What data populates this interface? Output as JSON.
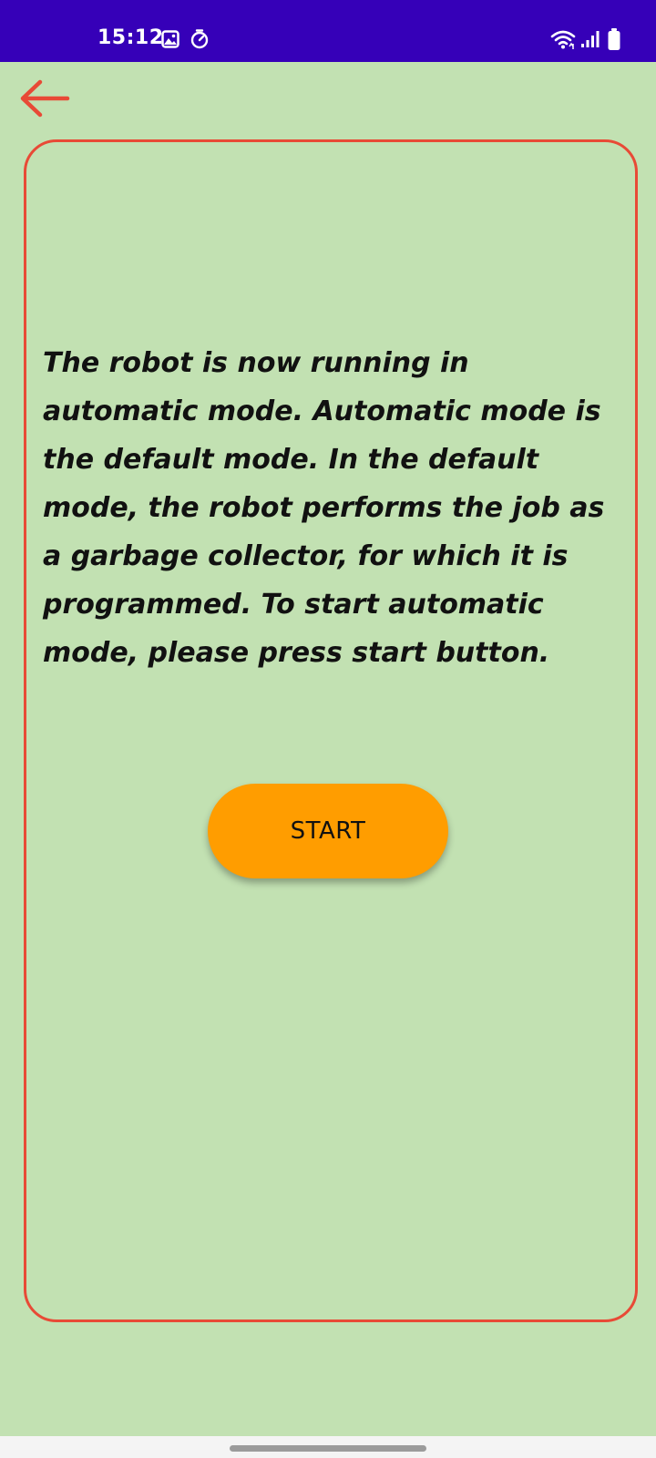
{
  "status_bar": {
    "time": "15:12",
    "left_icons": [
      "image-icon",
      "timer-icon"
    ],
    "right_icons": [
      "wifi-icon",
      "signal-icon",
      "battery-icon"
    ],
    "background": "#3600b8"
  },
  "nav": {
    "back_icon": "arrow-left-icon",
    "back_color": "#e84a36"
  },
  "card": {
    "message": "The robot is now running in automatic mode. Automatic mode is the default mode. In the default mode, the robot performs the job as a garbage collector, for which it is programmed. To start automatic mode, please press start button.",
    "border_color": "#e84a36"
  },
  "start_button": {
    "label": "START",
    "color": "#ff9d00"
  },
  "theme": {
    "background": "#c2e1b2",
    "text": "#111111"
  }
}
